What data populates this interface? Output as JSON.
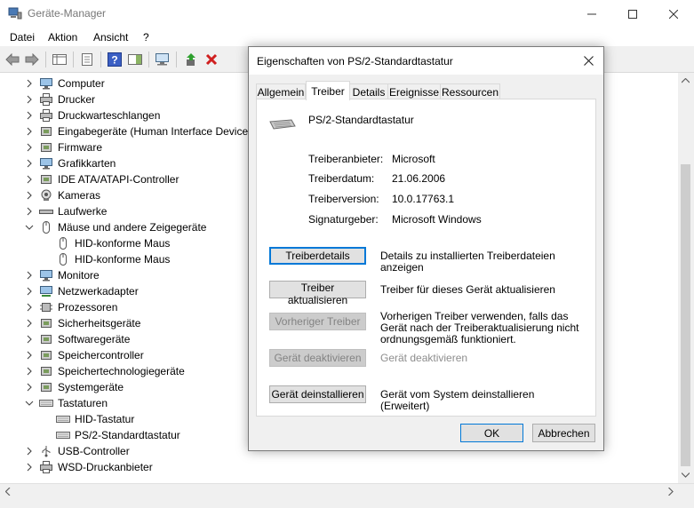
{
  "window": {
    "title": "Geräte-Manager",
    "menu": [
      "Datei",
      "Aktion",
      "Ansicht",
      "?"
    ]
  },
  "tree": [
    {
      "label": "Computer",
      "icon": "computer-icon",
      "level": 0,
      "expanded": false
    },
    {
      "label": "Drucker",
      "icon": "printer-icon",
      "level": 0,
      "expanded": false
    },
    {
      "label": "Druckwarteschlangen",
      "icon": "print-queue-icon",
      "level": 0,
      "expanded": false
    },
    {
      "label": "Eingabegeräte (Human Interface Devices)",
      "icon": "hid-icon",
      "level": 0,
      "expanded": false
    },
    {
      "label": "Firmware",
      "icon": "firmware-icon",
      "level": 0,
      "expanded": false
    },
    {
      "label": "Grafikkarten",
      "icon": "display-adapter-icon",
      "level": 0,
      "expanded": false
    },
    {
      "label": "IDE ATA/ATAPI-Controller",
      "icon": "ide-controller-icon",
      "level": 0,
      "expanded": false
    },
    {
      "label": "Kameras",
      "icon": "camera-icon",
      "level": 0,
      "expanded": false
    },
    {
      "label": "Laufwerke",
      "icon": "disk-drive-icon",
      "level": 0,
      "expanded": false
    },
    {
      "label": "Mäuse und andere Zeigegeräte",
      "icon": "mouse-icon",
      "level": 0,
      "expanded": true
    },
    {
      "label": "HID-konforme Maus",
      "icon": "mouse-icon",
      "level": 1
    },
    {
      "label": "HID-konforme Maus",
      "icon": "mouse-icon",
      "level": 1
    },
    {
      "label": "Monitore",
      "icon": "monitor-icon",
      "level": 0,
      "expanded": false
    },
    {
      "label": "Netzwerkadapter",
      "icon": "network-adapter-icon",
      "level": 0,
      "expanded": false
    },
    {
      "label": "Prozessoren",
      "icon": "processor-icon",
      "level": 0,
      "expanded": false
    },
    {
      "label": "Sicherheitsgeräte",
      "icon": "security-device-icon",
      "level": 0,
      "expanded": false
    },
    {
      "label": "Softwaregeräte",
      "icon": "software-device-icon",
      "level": 0,
      "expanded": false
    },
    {
      "label": "Speichercontroller",
      "icon": "storage-controller-icon",
      "level": 0,
      "expanded": false
    },
    {
      "label": "Speichertechnologiegeräte",
      "icon": "storage-technology-icon",
      "level": 0,
      "expanded": false
    },
    {
      "label": "Systemgeräte",
      "icon": "system-device-icon",
      "level": 0,
      "expanded": false
    },
    {
      "label": "Tastaturen",
      "icon": "keyboard-icon",
      "level": 0,
      "expanded": true
    },
    {
      "label": "HID-Tastatur",
      "icon": "keyboard-icon",
      "level": 1
    },
    {
      "label": "PS/2-Standardtastatur",
      "icon": "keyboard-icon",
      "level": 1
    },
    {
      "label": "USB-Controller",
      "icon": "usb-icon",
      "level": 0,
      "expanded": false
    },
    {
      "label": "WSD-Druckanbieter",
      "icon": "printer-icon",
      "level": 0,
      "expanded": false
    }
  ],
  "dialog": {
    "title": "Eigenschaften von PS/2-Standardtastatur",
    "tabs": [
      "Allgemein",
      "Treiber",
      "Details",
      "Ereignisse",
      "Ressourcen"
    ],
    "active_tab": "Treiber",
    "device_name": "PS/2-Standardtastatur",
    "info": [
      {
        "label": "Treiberanbieter:",
        "value": "Microsoft"
      },
      {
        "label": "Treiberdatum:",
        "value": "21.06.2006"
      },
      {
        "label": "Treiberversion:",
        "value": "10.0.17763.1"
      },
      {
        "label": "Signaturgeber:",
        "value": "Microsoft Windows"
      }
    ],
    "actions": [
      {
        "label": "Treiberdetails",
        "description": "Details zu installierten Treiberdateien anzeigen",
        "enabled": true
      },
      {
        "label": "Treiber aktualisieren",
        "description": "Treiber für dieses Gerät aktualisieren",
        "enabled": true
      },
      {
        "label": "Vorheriger Treiber",
        "description": "Vorherigen Treiber verwenden, falls das Gerät nach der Treiberaktualisierung nicht ordnungsgemäß funktioniert.",
        "enabled": false
      },
      {
        "label": "Gerät deaktivieren",
        "description": "Gerät deaktivieren",
        "enabled": false
      },
      {
        "label": "Gerät deinstallieren",
        "description": "Gerät vom System deinstallieren (Erweitert)",
        "enabled": true
      }
    ],
    "ok_label": "OK",
    "cancel_label": "Abbrechen"
  }
}
